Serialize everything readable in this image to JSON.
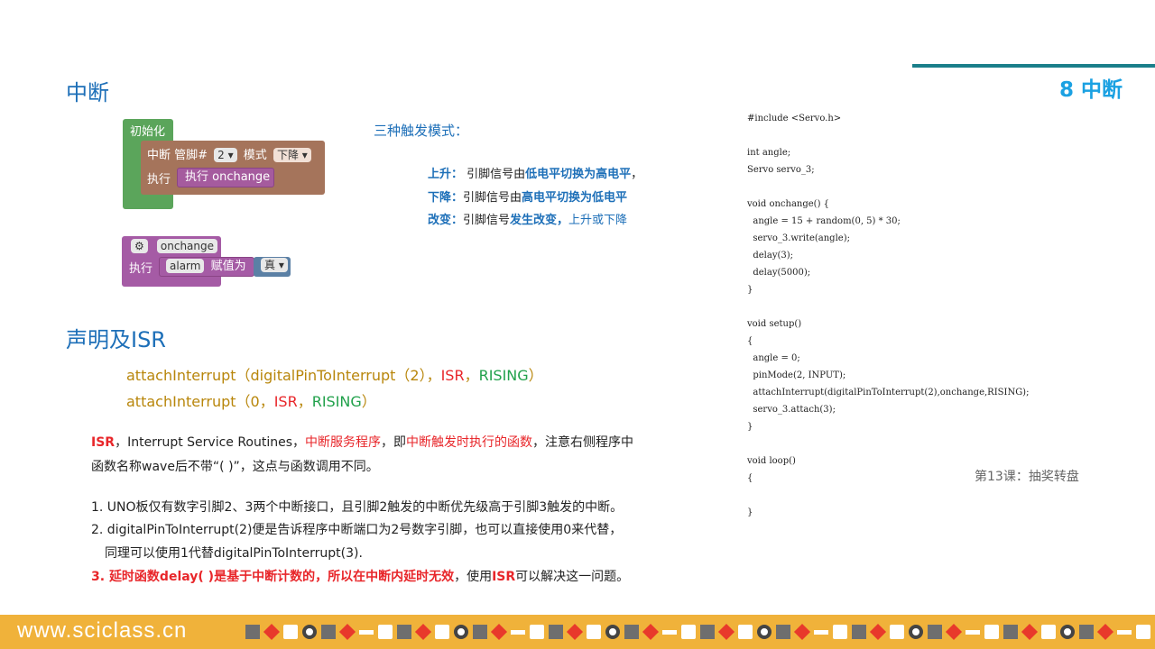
{
  "header": {
    "chapter": "8 中断",
    "section1": "中断",
    "section2": "声明及ISR"
  },
  "blocks": {
    "init": "初始化",
    "interrupt_label": "中断 管脚#",
    "pin": "2 ▾",
    "mode_label": "模式",
    "mode": "下降 ▾",
    "exec": "执行",
    "exec_inner": "执行  onchange",
    "func_icon": "⚙",
    "func_name": "onchange",
    "set_var": "alarm",
    "assign": "赋值为",
    "bool": "真 ▾"
  },
  "triggers": {
    "title": "三种触发模式：",
    "rising_k": "上升：",
    "rising_a": " 引脚信号由",
    "rising_b": "低电平切换为高电平",
    "rising_c": "，",
    "falling_k": "下降：",
    "falling_a": "引脚信号由",
    "falling_b": "高电平切换为低电平",
    "change_k": "改变：",
    "change_a": "引脚信号",
    "change_b": "发生改变，",
    "change_c": "上升或下降"
  },
  "attach": {
    "l1_fn": "attachInterrupt（digitalPinToInterrupt（2），",
    "l1_isr": "ISR",
    "l1_sep": "，",
    "l1_mode": "RISING",
    "l1_end": "）",
    "l2_fn": "attachInterrupt（0，",
    "l2_isr": "ISR",
    "l2_sep": "，",
    "l2_mode": "RISING",
    "l2_end": "）"
  },
  "explain": {
    "p1a": "ISR",
    "p1b": "，Interrupt Service Routines，",
    "p1c": "中断服务程序",
    "p1d": "，即",
    "p1e": "中断触发时执行的函数",
    "p1f": "，注意右侧程序中",
    "p2": "函数名称wave后不带“( )”，这点与函数调用不同。",
    "n1": "1. UNO板仅有数字引脚2、3两个中断接口，且引脚2触发的中断优先级高于引脚3触发的中断。",
    "n2": "2. digitalPinToInterrupt(2)便是告诉程序中断端口为2号数字引脚，也可以直接使用0来代替，",
    "n2b": "同理可以使用1代替digitalPinToInterrupt(3).",
    "n3a": "3. ",
    "n3b": "延时函数delay( )是基于中断计数的，所以在中断内延时无效",
    "n3c": "，使用",
    "n3d": "ISR",
    "n3e": "可以解决这一问题。"
  },
  "code_lines": [
    "#include <Servo.h>",
    "",
    "int angle;",
    "Servo servo_3;",
    "",
    "void onchange() {",
    "  angle = 15 + random(0, 5) * 30;",
    "  servo_3.write(angle);",
    "  delay(3);",
    "  delay(5000);",
    "}",
    "",
    "void setup()",
    "{",
    "  angle = 0;",
    "  pinMode(2, INPUT);",
    "  attachInterrupt(digitalPinToInterrupt(2),onchange,RISING);",
    "  servo_3.attach(3);",
    "}",
    "",
    "void loop()",
    "{",
    "",
    "}"
  ],
  "lesson": "第13课：抽奖转盘",
  "footer": {
    "url": "www.sciclass.cn"
  },
  "colors": {
    "accent": "#1d6fb8",
    "chapter": "#1ba1e2",
    "red": "#e8262a",
    "green": "#21a14b",
    "gold": "#b8860b",
    "footer": "#f0b23a"
  }
}
